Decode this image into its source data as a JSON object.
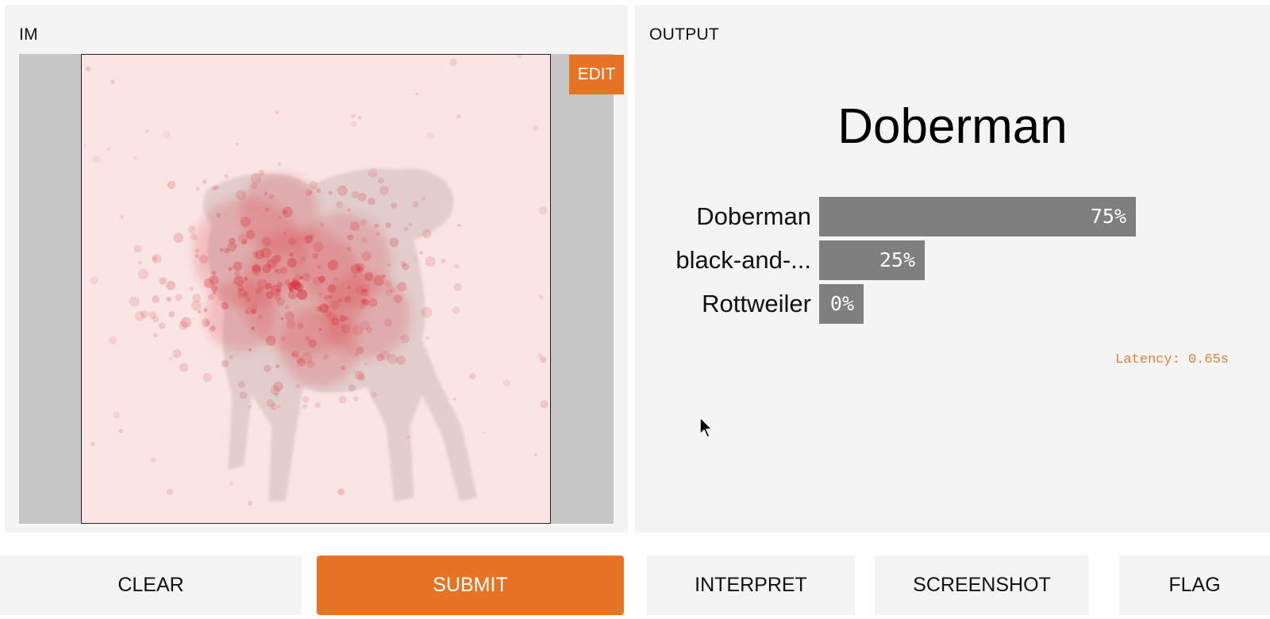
{
  "input_panel": {
    "label": "IM",
    "edit_label": "EDIT"
  },
  "output_panel": {
    "label": "OUTPUT",
    "top_prediction": "Doberman",
    "confidences": [
      {
        "label": "Doberman",
        "percent_text": "75%",
        "value": 0.75
      },
      {
        "label": "black-and-...",
        "percent_text": "25%",
        "value": 0.25
      },
      {
        "label": "Rottweiler",
        "percent_text": "0%",
        "value": 0.0
      }
    ],
    "latency": "Latency: 0.65s"
  },
  "actions": {
    "clear": "CLEAR",
    "submit": "SUBMIT",
    "interpret": "INTERPRET",
    "screenshot": "SCREENSHOT",
    "flag": "FLAG"
  },
  "colors": {
    "accent": "#e67424",
    "bar": "#7f7f7f",
    "panel_bg": "#f4f4f4",
    "heatmap_red": "#d9363e",
    "latency_text": "#e0803a"
  },
  "icons": {
    "cursor": "arrow-cursor-icon"
  }
}
